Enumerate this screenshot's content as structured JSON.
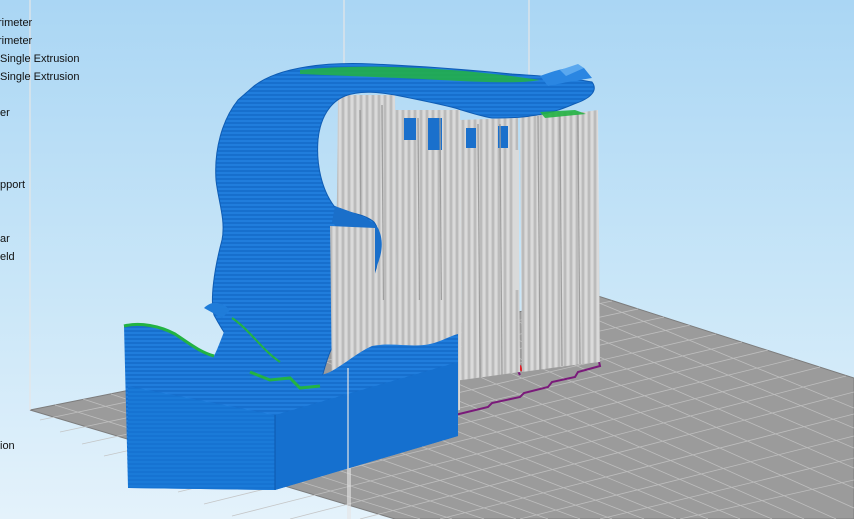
{
  "legend": {
    "items": [
      {
        "label": "rimeter",
        "color": "#ff9c00"
      },
      {
        "label": "rimeter",
        "color": "#ff2a2a"
      },
      {
        "label": "Single Extrusion",
        "color": "#00b000"
      },
      {
        "label": "Single Extrusion",
        "color": "#006000"
      },
      {
        "label": "er",
        "color": "#0070e0"
      },
      {
        "label": "pport",
        "color": "#b0b0b0"
      },
      {
        "label": "ar",
        "color": "#7a1a7a"
      },
      {
        "label": "eld",
        "color": "#c0c0c0"
      },
      {
        "label": "ion",
        "color": "#909090"
      }
    ]
  },
  "colors": {
    "background_top": "#aad6f4",
    "background_bottom": "#e4f2fb",
    "build_plate": "#9a9a9a",
    "grid_lines": "#bdbdbd",
    "model_blue": "#1b78d8",
    "model_highlight": "#23b343",
    "support_gray": "#c4c4c4",
    "skirt_purple": "#7a1a7a"
  }
}
